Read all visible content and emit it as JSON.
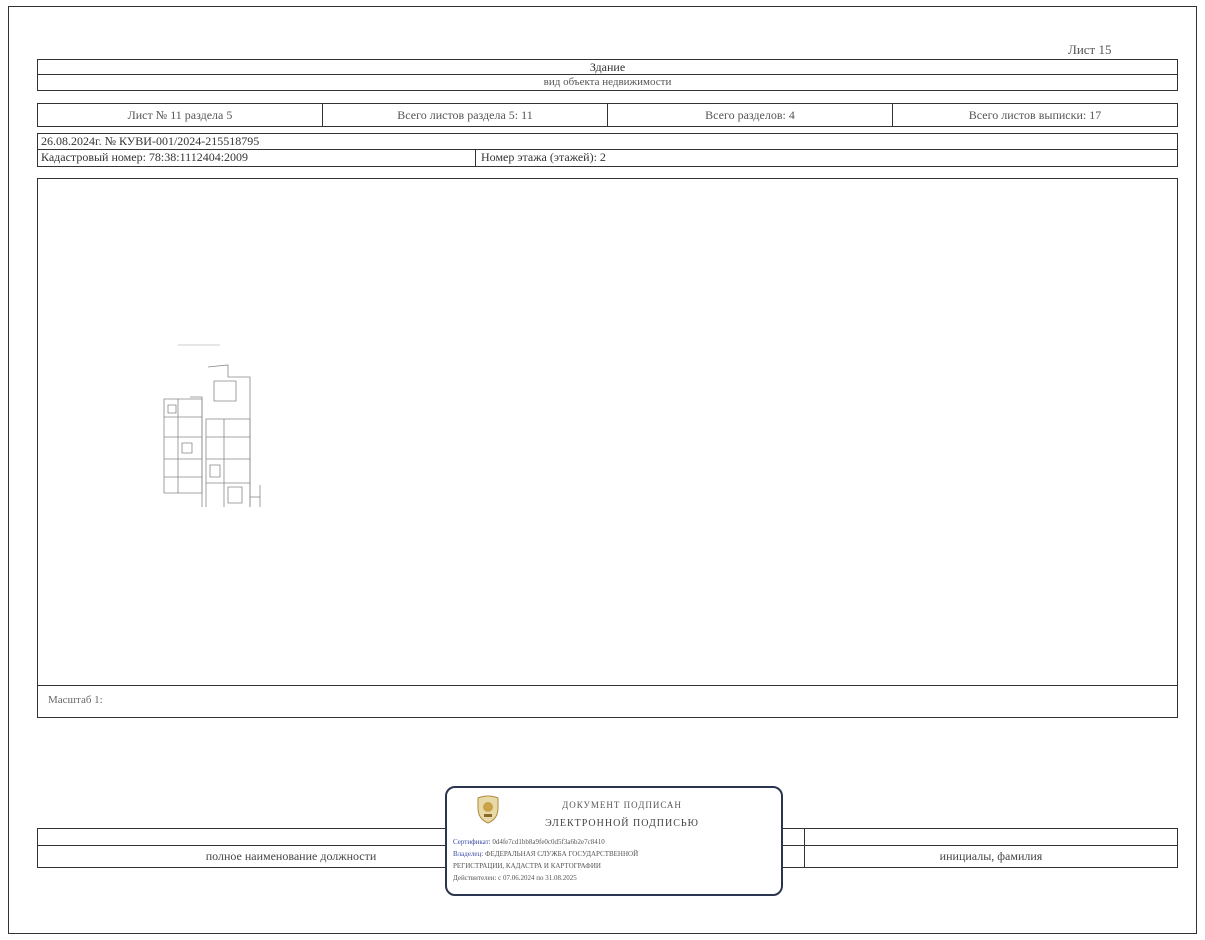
{
  "sheet": {
    "label": "Лист 15"
  },
  "header": {
    "object_type": "Здание",
    "object_type_caption": "вид объекта недвижимости"
  },
  "info_row": [
    "Лист № 11 раздела 5",
    "Всего листов раздела 5: 11",
    "Всего разделов: 4",
    "Всего листов выписки: 17"
  ],
  "record": {
    "date_number": "26.08.2024г. № КУВИ-001/2024-215518795",
    "cadastral_number": "Кадастровый номер: 78:38:1112404:2009",
    "floor_number": "Номер этажа (этажей): 2"
  },
  "plan": {
    "scale_label": "Масштаб 1:"
  },
  "signature": {
    "position_caption": "полное наименование должности",
    "name_caption": "инициалы, фамилия"
  },
  "stamp": {
    "title_line1": "ДОКУМЕНТ ПОДПИСАН",
    "title_line2": "ЭЛЕКТРОННОЙ ПОДПИСЬЮ",
    "lines": [
      {
        "key": "Сертификат:",
        "value": "0d4fe7cd1bb8a9fe0c0d5f3a6b2e7c8410"
      },
      {
        "key": "Владелец:",
        "value": "ФЕДЕРАЛЬНАЯ СЛУЖБА ГОСУДАРСТВЕННОЙ"
      },
      {
        "key": "",
        "value": "РЕГИСТРАЦИИ, КАДАСТРА И КАРТОГРАФИИ"
      },
      {
        "key": "",
        "value": "Действителен: с 07.06.2024 по 31.08.2025"
      }
    ]
  }
}
